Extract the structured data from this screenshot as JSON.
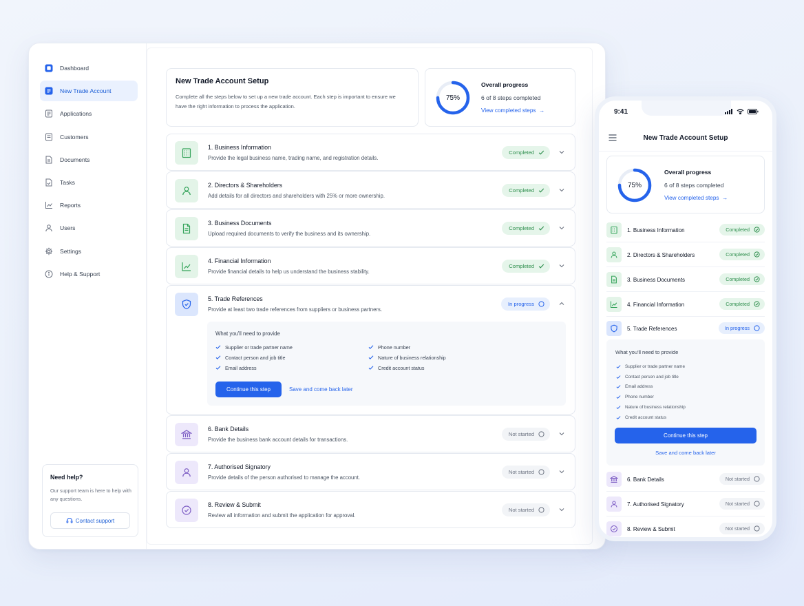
{
  "sidebar": {
    "items": [
      {
        "label": "Dashboard",
        "icon": "dashboard-icon",
        "active": false
      },
      {
        "label": "New Trade Account",
        "icon": "document-icon",
        "active": true
      },
      {
        "label": "Applications",
        "icon": "applications-icon",
        "active": false
      },
      {
        "label": "Customers",
        "icon": "customers-icon",
        "active": false
      },
      {
        "label": "Documents",
        "icon": "documents-icon",
        "active": false
      },
      {
        "label": "Tasks",
        "icon": "tasks-icon",
        "active": false
      },
      {
        "label": "Reports",
        "icon": "reports-icon",
        "active": false
      },
      {
        "label": "Users",
        "icon": "users-icon",
        "active": false
      },
      {
        "label": "Settings",
        "icon": "gear-icon",
        "active": false
      },
      {
        "label": "Help & Support",
        "icon": "help-icon",
        "active": false
      }
    ],
    "help": {
      "title": "Need help?",
      "text": "Our support team is here to help with any questions.",
      "button": "Contact support"
    }
  },
  "intro": {
    "title": "New Trade Account Setup",
    "description": "Complete all the steps below to set up a new trade account. Each step is important to ensure we have the right information to process the application."
  },
  "progress": {
    "percent_label": "75%",
    "percent": 0.75,
    "title": "Overall progress",
    "subtitle": "6 of 8 steps completed",
    "link": "View completed steps"
  },
  "steps": [
    {
      "title": "1. Business Information",
      "description": "Provide the legal business name, trading name, and registration details.",
      "status": "Completed",
      "icon": "building-icon"
    },
    {
      "title": "2. Directors & Shareholders",
      "description": "Add details for all directors and shareholders with 25% or more ownership.",
      "status": "Completed",
      "icon": "person-icon"
    },
    {
      "title": "3. Business Documents",
      "description": "Upload required documents to verify the business and its ownership.",
      "status": "Completed",
      "icon": "file-icon"
    },
    {
      "title": "4. Financial Information",
      "description": "Provide financial details to help us understand the business stability.",
      "status": "Completed",
      "icon": "chart-icon"
    },
    {
      "title": "5. Trade References",
      "description": "Provide at least two trade references from suppliers or business partners.",
      "status": "In progress",
      "icon": "shield-icon"
    },
    {
      "title": "6. Bank Details",
      "description": "Provide the business bank account details for transactions.",
      "status": "Not started",
      "icon": "bank-icon"
    },
    {
      "title": "7. Authorised Signatory",
      "description": "Provide details of the person authorised to manage the account.",
      "status": "Not started",
      "icon": "person-icon"
    },
    {
      "title": "8. Review & Submit",
      "description": "Review all information and submit the application for approval.",
      "status": "Not started",
      "icon": "check-circle-icon"
    }
  ],
  "requirements": {
    "title": "What you'll need to provide",
    "items": [
      "Supplier or trade partner name",
      "Phone number",
      "Contact person and job title",
      "Nature of business relationship",
      "Email address",
      "Credit account status"
    ],
    "mobile_items": [
      "Supplier or trade partner name",
      "Contact person and job title",
      "Email address",
      "Phone number",
      "Nature of business relationship",
      "Credit account status"
    ],
    "continue_label": "Continue this step",
    "save_label": "Save and come back later"
  },
  "mobile": {
    "time": "9:41",
    "title": "New Trade Account Setup"
  },
  "colors": {
    "accent": "#2563eb",
    "completed": "#2f8f4e",
    "in_progress": "#2563eb",
    "not_started": "#6b7280"
  }
}
